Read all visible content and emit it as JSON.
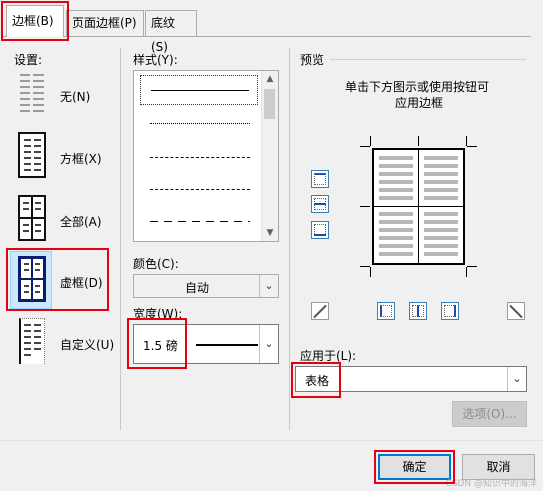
{
  "tabs": [
    {
      "label": "边框(B)",
      "active": true
    },
    {
      "label": "页面边框(P)",
      "active": false
    },
    {
      "label": "底纹(S)",
      "active": false
    }
  ],
  "settings": {
    "heading": "设置:",
    "options": [
      {
        "label": "无(N)",
        "icon": "setting-none-icon"
      },
      {
        "label": "方框(X)",
        "icon": "setting-box-icon"
      },
      {
        "label": "全部(A)",
        "icon": "setting-all-icon"
      },
      {
        "label": "虚框(D)",
        "icon": "setting-grid-icon",
        "selected": true
      },
      {
        "label": "自定义(U)",
        "icon": "setting-custom-icon"
      }
    ]
  },
  "style": {
    "heading": "样式(Y):",
    "items": [
      "solid",
      "dotted",
      "dashed-small",
      "dashed",
      "dash-long"
    ]
  },
  "color": {
    "heading": "颜色(C):",
    "value": "自动"
  },
  "width": {
    "heading": "宽度(W):",
    "value": "1.5 磅"
  },
  "preview": {
    "heading": "预览",
    "hint_line1": "单击下方图示或使用按钮可",
    "hint_line2": "应用边框"
  },
  "apply_to": {
    "heading": "应用于(L):",
    "value": "表格"
  },
  "buttons": {
    "options": "选项(O)...",
    "ok": "确定",
    "cancel": "取消"
  },
  "watermark": "CSDN @知识中的海洋",
  "colors": {
    "highlight": "#e60012",
    "accent": "#0078d7"
  }
}
